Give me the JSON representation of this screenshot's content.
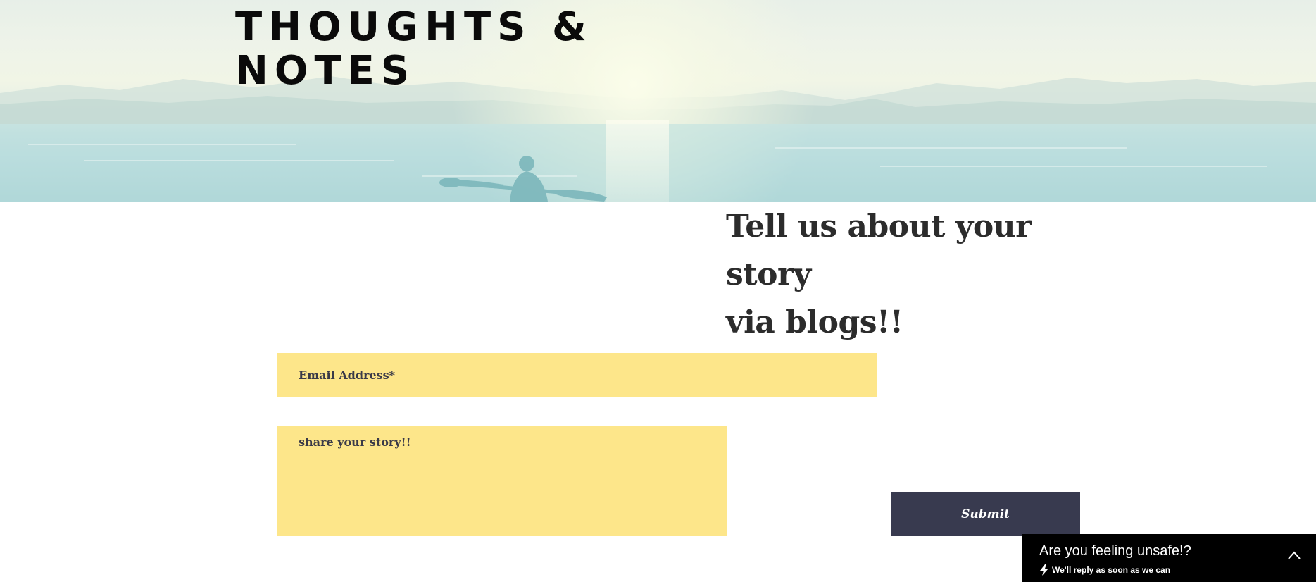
{
  "hero": {
    "title_line1": "THOUGHTS &",
    "title_line2": "NOTES"
  },
  "story": {
    "heading_line1": "Tell us about your story",
    "heading_line2": "via blogs!!"
  },
  "form": {
    "email_placeholder": "Email Address*",
    "story_placeholder": "share your story!!",
    "submit_label": "Submit"
  },
  "chat": {
    "title": "Are you feeling unsafe!?",
    "subtitle": "We'll reply as soon as we can",
    "icons": [
      "bolt-icon",
      "chevron-up-icon"
    ]
  },
  "colors": {
    "field_background": "#fde68a",
    "submit_background": "#383a4f",
    "chat_background": "#000000",
    "heading_text": "#2c2c2c"
  }
}
